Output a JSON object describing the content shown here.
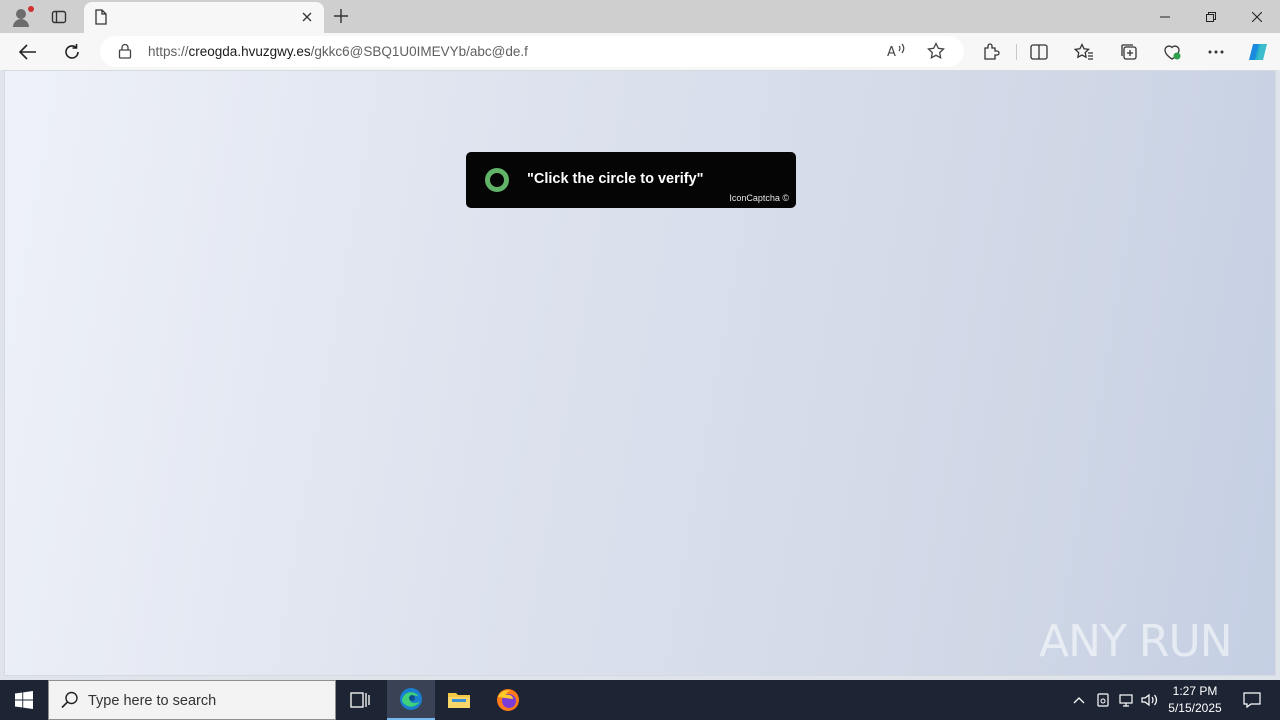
{
  "browser": {
    "tab_title": "",
    "url_prefix": "https://",
    "url_host": "creogda.hvuzgwy.es",
    "url_path": "/gkkc6@SBQ1U0IMEVYb/abc@de.f"
  },
  "captcha": {
    "message": "\"Click the circle to verify\"",
    "brand": "IconCaptcha ©",
    "accent_color": "#62b268"
  },
  "watermark": {
    "text": "ANY RUN"
  },
  "taskbar": {
    "search_placeholder": "Type here to search",
    "time": "1:27 PM",
    "date": "5/15/2025",
    "apps": [
      "task-view-icon",
      "edge-icon",
      "file-explorer-icon",
      "firefox-icon"
    ]
  }
}
